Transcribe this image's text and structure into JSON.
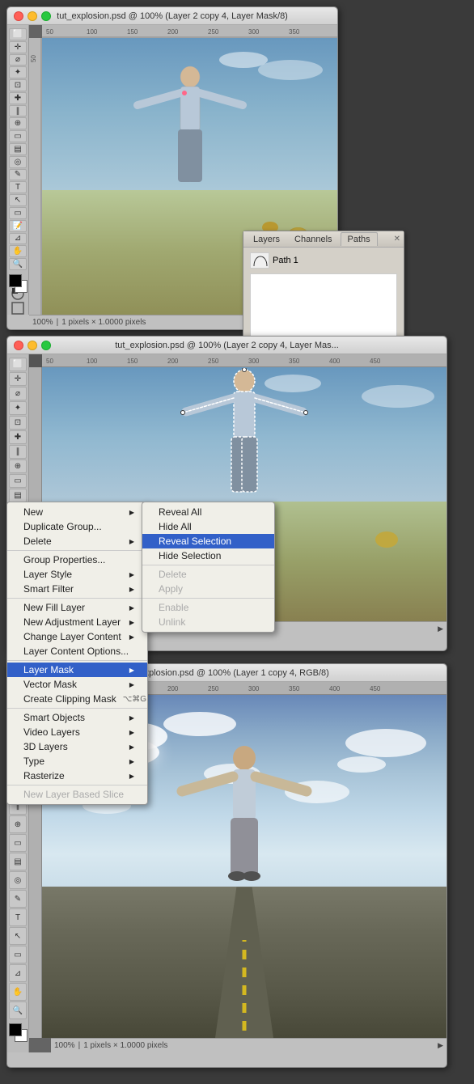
{
  "app": {
    "title1": "tut_explosion.psd @ 100% (Layer 2 copy 4, Layer Mask/8)",
    "title2": "tut_explosion.psd @ 100% (Layer 2 copy 4, Layer Mas...",
    "title3": "tut_explosion.psd @ 100% (Layer 1 copy 4, RGB/8)",
    "zoom1": "100%",
    "zoom3": "100%",
    "status1": "1 pixels × 1.0000 pixels",
    "status3": "1 pixels × 1.0000 pixels"
  },
  "paths_panel": {
    "tabs": [
      "Layers",
      "Channels",
      "Paths"
    ],
    "active_tab": "Paths",
    "items": [
      {
        "name": "Path 1"
      }
    ],
    "footer_buttons": [
      "new-path",
      "load-selection",
      "make-work-path",
      "add-mask",
      "create-new-path",
      "delete-path"
    ]
  },
  "context_menu": {
    "items": [
      {
        "label": "New",
        "has_arrow": true,
        "disabled": false,
        "active": false
      },
      {
        "label": "Duplicate Group...",
        "has_arrow": false,
        "disabled": false,
        "active": false
      },
      {
        "label": "Delete",
        "has_arrow": true,
        "disabled": false,
        "active": false
      },
      {
        "label": "",
        "separator": true
      },
      {
        "label": "Group Properties...",
        "has_arrow": false,
        "disabled": false,
        "active": false
      },
      {
        "label": "Layer Style",
        "has_arrow": true,
        "disabled": false,
        "active": false
      },
      {
        "label": "Smart Filter",
        "has_arrow": true,
        "disabled": false,
        "active": false
      },
      {
        "label": "",
        "separator": true
      },
      {
        "label": "New Fill Layer",
        "has_arrow": true,
        "disabled": false,
        "active": false
      },
      {
        "label": "New Adjustment Layer",
        "has_arrow": true,
        "disabled": false,
        "active": false
      },
      {
        "label": "Change Layer Content",
        "has_arrow": true,
        "disabled": false,
        "active": false
      },
      {
        "label": "Layer Content Options...",
        "has_arrow": false,
        "disabled": false,
        "active": false
      },
      {
        "label": "",
        "separator": true
      },
      {
        "label": "Layer Mask",
        "has_arrow": true,
        "disabled": false,
        "active": true
      },
      {
        "label": "Vector Mask",
        "has_arrow": true,
        "disabled": false,
        "active": false
      },
      {
        "label": "Create Clipping Mask",
        "has_arrow": false,
        "shortcut": "⌥⌘G",
        "disabled": false,
        "active": false
      },
      {
        "label": "",
        "separator": true
      },
      {
        "label": "Smart Objects",
        "has_arrow": true,
        "disabled": false,
        "active": false
      },
      {
        "label": "Video Layers",
        "has_arrow": true,
        "disabled": false,
        "active": false
      },
      {
        "label": "3D Layers",
        "has_arrow": true,
        "disabled": false,
        "active": false
      },
      {
        "label": "Type",
        "has_arrow": true,
        "disabled": false,
        "active": false
      },
      {
        "label": "Rasterize",
        "has_arrow": true,
        "disabled": false,
        "active": false
      },
      {
        "label": "",
        "separator": true
      },
      {
        "label": "New Layer Based Slice",
        "has_arrow": false,
        "disabled": true,
        "active": false
      }
    ]
  },
  "submenu": {
    "items": [
      {
        "label": "Reveal All",
        "disabled": false,
        "active": false
      },
      {
        "label": "Hide All",
        "disabled": false,
        "active": false
      },
      {
        "label": "Reveal Selection",
        "disabled": false,
        "active": true
      },
      {
        "label": "Hide Selection",
        "disabled": false,
        "active": false
      },
      {
        "label": "",
        "separator": true
      },
      {
        "label": "Delete",
        "disabled": true,
        "active": false
      },
      {
        "label": "Apply",
        "disabled": true,
        "active": false
      },
      {
        "label": "",
        "separator": true
      },
      {
        "label": "Enable",
        "disabled": true,
        "active": false
      },
      {
        "label": "Unlink",
        "disabled": true,
        "active": false
      }
    ]
  },
  "tools": [
    "marquee",
    "move",
    "lasso",
    "magic-wand",
    "crop",
    "slice",
    "healing",
    "brush",
    "stamp",
    "history-brush",
    "eraser",
    "gradient",
    "dodge",
    "pen",
    "text",
    "path-selection",
    "shape",
    "notes",
    "eyedropper",
    "hand",
    "zoom"
  ],
  "colors": {
    "bg": "#3a3a3a",
    "titlebar_from": "#e8e8e8",
    "titlebar_to": "#d0d0d0",
    "canvas_bg": "#646464",
    "menu_bg": "#f0efe8",
    "menu_active": "#3260c8",
    "panel_bg": "#d4d0c8",
    "accent_red": "#cc2222",
    "pink_dot": "#ff6688"
  }
}
